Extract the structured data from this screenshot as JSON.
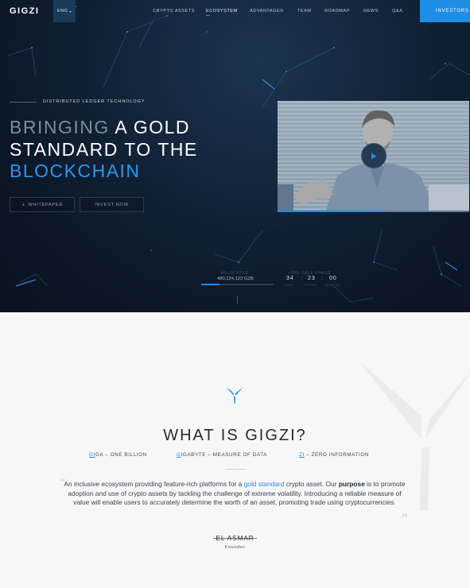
{
  "nav": {
    "logo": "GIGZI",
    "language": "ENG",
    "items": [
      {
        "label": "CRYPTO ASSETS"
      },
      {
        "label": "ECOSYSTEM",
        "active": true
      },
      {
        "label": "ADVANTAGES"
      },
      {
        "label": "TEAM"
      },
      {
        "label": "ROADMAP"
      },
      {
        "label": "NEWS"
      },
      {
        "label": "Q&A"
      }
    ],
    "investors_label": "INVESTORS"
  },
  "hero": {
    "eyebrow": "DISTRIBUTED LEDGER TECHNOLOGY",
    "headline": {
      "dim": "BRINGING",
      "rest1": " A GOLD",
      "line2": "STANDARD TO THE",
      "blue": "BLOCKCHAIN"
    },
    "whitepaper_label": "WHITEPAPER",
    "invest_label": "INVEST NOW",
    "video": {
      "progress": 0.55,
      "play_icon": "play-icon"
    },
    "allocated": {
      "label": "ALLOCATED",
      "value": "480,124,123 GZB",
      "progress": 0.25
    },
    "presale": {
      "label": "PRE-SALE PHASE",
      "days": "34",
      "hours": "23",
      "minutes": "00",
      "days_label": "DAYS",
      "hours_label": "HOURS",
      "minutes_label": "MINUTES"
    }
  },
  "about": {
    "title": "WHAT IS GIGZI?",
    "definitions": [
      {
        "letter": "GI",
        "text": "GA – ONE BILLION"
      },
      {
        "letter": "G",
        "text": "IGABYTE – MEASURE OF DATA"
      },
      {
        "letter": "ZI",
        "text": " – ZERO INFORMATION"
      }
    ],
    "quote": {
      "p1": "An inclusive ecosystem providing feature-rich platforms for a ",
      "link": "gold standard",
      "p2": " crypto asset. Our ",
      "bold": "purpose",
      "p3": " is to promote adoption and use of crypto assets by tackling the challenge of extreme volatility. Introducing a reliable measure of value will enable users to accurately determine the worth of an asset, promoting trade using cryptocurrencies."
    },
    "author": "EL ASMAR",
    "role": "Founder"
  },
  "colors": {
    "accent": "#1e8de6",
    "hero_bg": "#0b1726",
    "text_dark": "#1f2a36"
  }
}
